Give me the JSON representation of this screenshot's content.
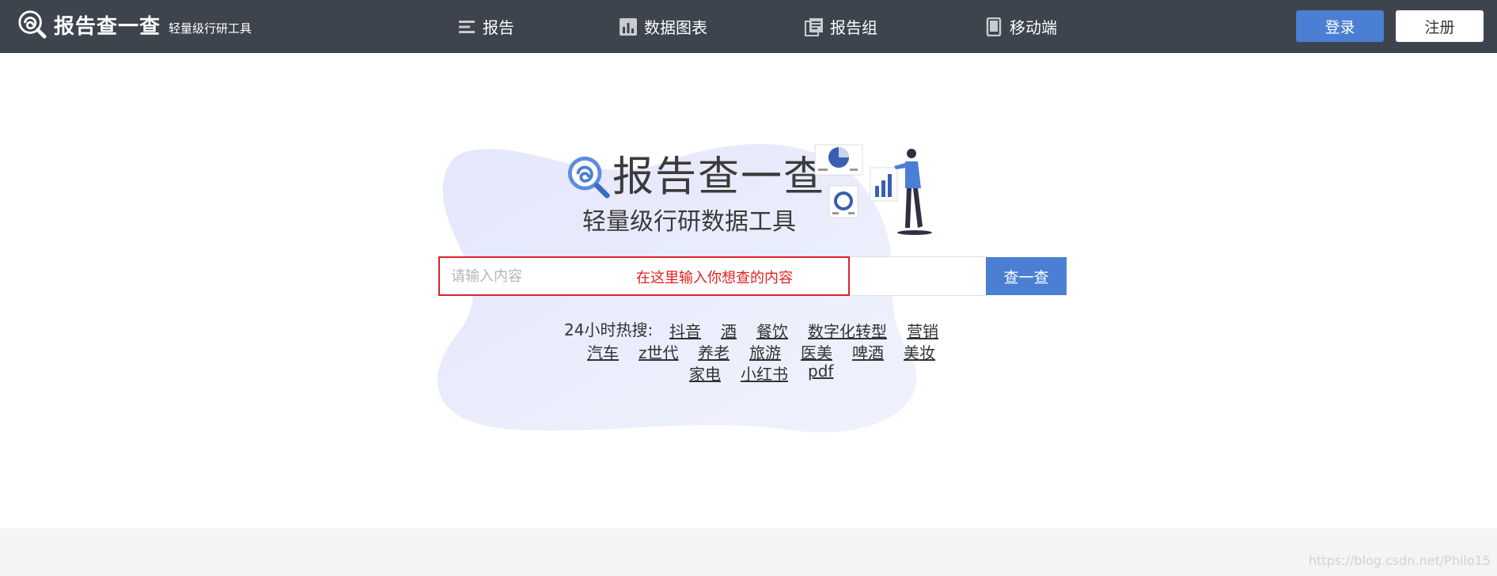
{
  "header": {
    "logo_name": "报告查一查",
    "logo_sub": "轻量级行研工具",
    "nav": [
      {
        "label": "报告",
        "icon": "menu-lines-icon"
      },
      {
        "label": "数据图表",
        "icon": "bar-chart-icon"
      },
      {
        "label": "报告组",
        "icon": "document-stack-icon"
      },
      {
        "label": "移动端",
        "icon": "mobile-phone-icon"
      }
    ],
    "login_label": "登录",
    "register_label": "注册"
  },
  "hero": {
    "title": "报告查一查",
    "subtitle": "轻量级行研数据工具"
  },
  "search": {
    "placeholder": "请输入内容",
    "annotation": "在这里输入你想查的内容",
    "button_label": "查一查"
  },
  "hot": {
    "label": "24小时热搜:",
    "row1": [
      "抖音",
      "酒",
      "餐饮",
      "数字化转型",
      "营销"
    ],
    "row2": [
      "汽车",
      "z世代",
      "养老",
      "旅游",
      "医美",
      "啤酒",
      "美妆"
    ],
    "row3": [
      "家电",
      "小红书",
      "pdf"
    ]
  },
  "watermark": "https://blog.csdn.net/Philo15",
  "colors": {
    "header_bg": "#3d444d",
    "accent": "#4a7fd4",
    "annotation_red": "#e02020",
    "footer_bg": "#f3f4f6"
  }
}
